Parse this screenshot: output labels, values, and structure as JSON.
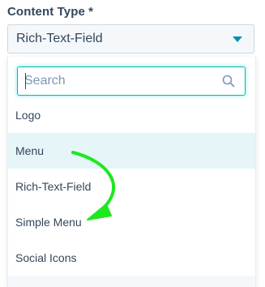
{
  "field": {
    "label": "Content Type *",
    "selected_value": "Rich-Text-Field"
  },
  "dropdown": {
    "search_placeholder": "Search",
    "options": [
      {
        "label": "Logo"
      },
      {
        "label": "Menu",
        "highlighted": true
      },
      {
        "label": "Rich-Text-Field"
      },
      {
        "label": "Simple Menu"
      },
      {
        "label": "Social Icons"
      }
    ]
  },
  "icons": {
    "caret": "chevron-down-icon",
    "search": "search-icon",
    "annotation": "curved-arrow-icon"
  },
  "colors": {
    "accent": "#0091ae",
    "focus_border": "#00bda5",
    "highlight_row": "#e5f5f8",
    "text": "#33475b",
    "annotation_arrow": "#1ee81e"
  }
}
